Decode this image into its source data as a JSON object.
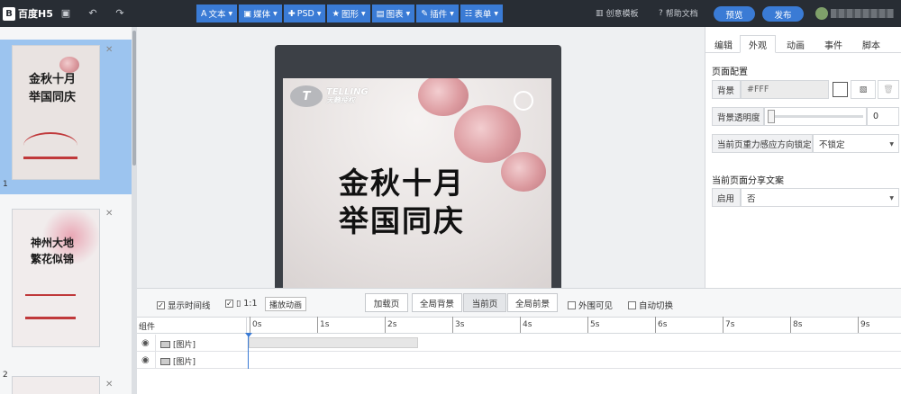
{
  "app": {
    "name": "百度H5"
  },
  "toolbar": {
    "save_icon": "save-icon",
    "undo_icon": "undo-icon",
    "redo_icon": "redo-icon",
    "tools": [
      {
        "name": "text",
        "label": "文本",
        "icon": "A"
      },
      {
        "name": "media",
        "label": "媒体",
        "icon": "▣"
      },
      {
        "name": "psd",
        "label": "PSD",
        "icon": "✚"
      },
      {
        "name": "shape",
        "label": "图形",
        "icon": "★"
      },
      {
        "name": "chart",
        "label": "图表",
        "icon": "▤"
      },
      {
        "name": "plugin",
        "label": "插件",
        "icon": "✎"
      },
      {
        "name": "form",
        "label": "表单",
        "icon": "☷"
      }
    ],
    "template_link": "创意模板",
    "help_link": "帮助文档",
    "preview": "预览",
    "publish": "发布"
  },
  "pages": [
    {
      "num": "1",
      "title_line1": "金秋十月",
      "title_line2": "举国同庆",
      "selected": true
    },
    {
      "num": "2",
      "title_line1": "神州大地",
      "title_line2": "繁花似锦",
      "selected": false
    }
  ],
  "canvas": {
    "brand_name": "TELLING",
    "brand_sub": "天籁授权",
    "title_line1": "金秋十月",
    "title_line2": "举国同庆"
  },
  "right_panel": {
    "tabs": [
      "编辑",
      "外观",
      "动画",
      "事件",
      "脚本"
    ],
    "active_tab": "外观",
    "page_config_title": "页面配置",
    "bg_label": "背景",
    "bg_value": "#FFF",
    "opacity_label": "背景透明度",
    "opacity_value": "0",
    "gravity_label": "当前页重力感应方向锁定",
    "gravity_value": "不锁定",
    "share_title": "当前页面分享文案",
    "enable_label": "启用",
    "enable_value": "否"
  },
  "timeline": {
    "show_timeline": "显示时间线",
    "ratio_label": "1:1",
    "play_anim": "播放动画",
    "segments": [
      "加载页",
      "全局背景",
      "当前页",
      "全局前景"
    ],
    "active_segment": "当前页",
    "outside_visible": "外围可见",
    "auto_switch": "自动切换",
    "component_header": "组件",
    "ticks": [
      "0s",
      "1s",
      "2s",
      "3s",
      "4s",
      "5s",
      "6s",
      "7s",
      "8s",
      "9s"
    ],
    "rows": [
      {
        "label": "[图片]",
        "has_bar": true
      },
      {
        "label": "[图片]",
        "has_bar": false
      }
    ]
  },
  "colors": {
    "accent": "#3a7bd5",
    "topbar": "#282d34"
  }
}
